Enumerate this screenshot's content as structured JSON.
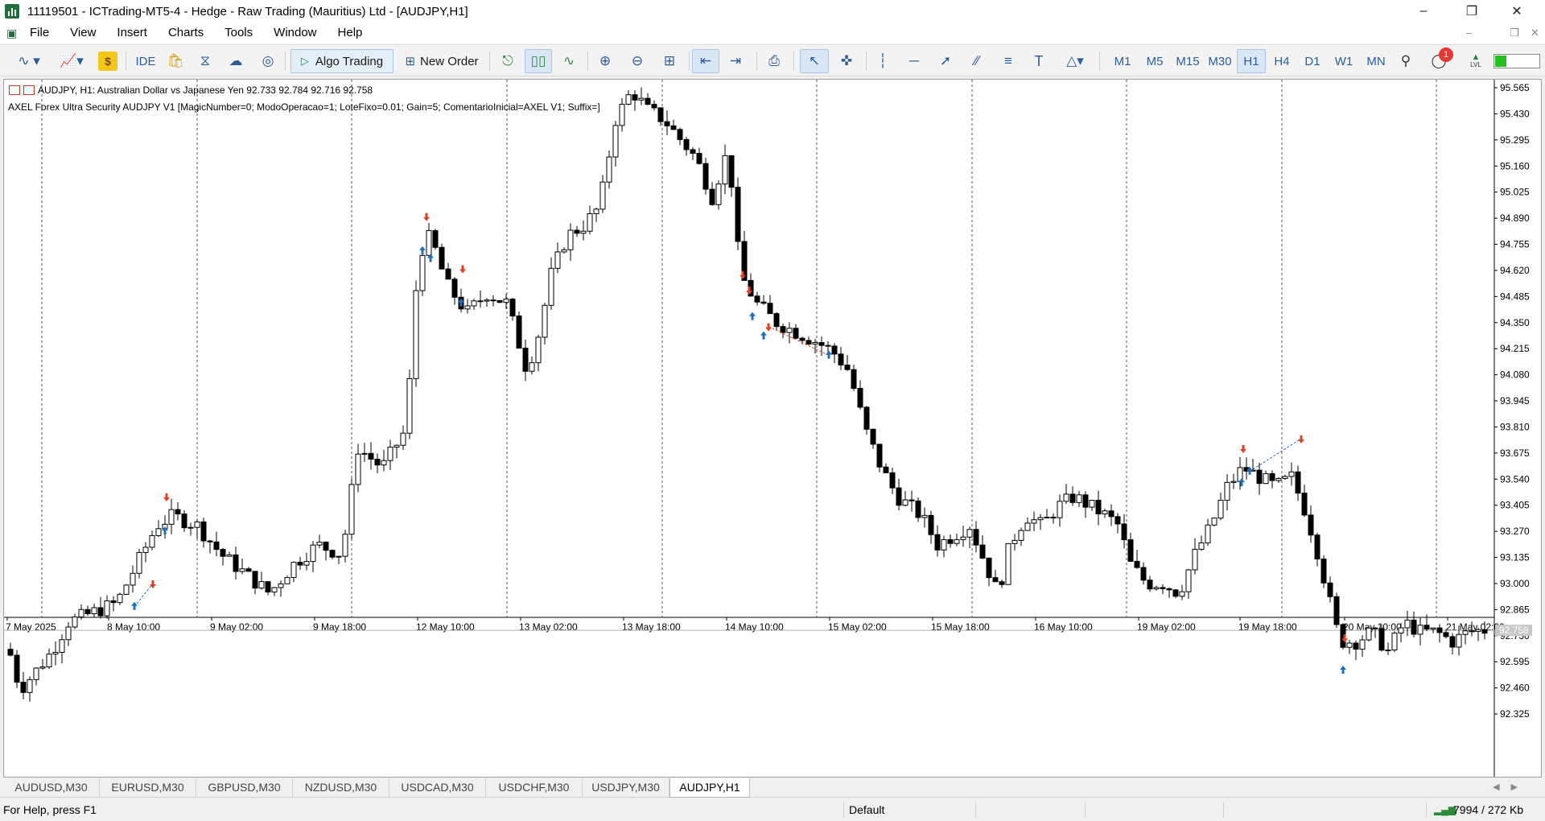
{
  "window": {
    "title": "11119501 - ICTrading-MT5-4 - Hedge - Raw Trading (Mauritius) Ltd - [AUDJPY,H1]"
  },
  "menu": [
    "File",
    "View",
    "Insert",
    "Charts",
    "Tools",
    "Window",
    "Help"
  ],
  "toolbar": {
    "ide_label": "IDE",
    "algo_trading_label": "Algo Trading",
    "new_order_label": "New Order",
    "timeframes": [
      "M1",
      "M5",
      "M15",
      "M30",
      "H1",
      "H4",
      "D1",
      "W1",
      "MN"
    ],
    "active_timeframe": "H1",
    "notification_count": "1",
    "lvl_label": "LVL"
  },
  "chart": {
    "info_line": "AUDJPY, H1:  Australian Dollar vs Japanese Yen  92.733 92.784 92.716 92.758",
    "ea_line": "AXEL Forex Ultra Security AUDJPY V1 [MagicNumber=0; ModoOperacao=1; LoteFixo=0.01; Gain=5; ComentarioInicial=AXEL V1; Suffix=]",
    "current_price": "92.758",
    "price_labels": [
      "95.565",
      "95.430",
      "95.295",
      "95.160",
      "95.025",
      "94.890",
      "94.755",
      "94.620",
      "94.485",
      "94.350",
      "94.215",
      "94.080",
      "93.945",
      "93.810",
      "93.675",
      "93.540",
      "93.405",
      "93.270",
      "93.135",
      "93.000",
      "92.865",
      "92.730",
      "92.595",
      "92.460",
      "92.325"
    ],
    "time_labels": [
      "7 May 2025",
      "8 May 10:00",
      "9 May 02:00",
      "9 May 18:00",
      "12 May 10:00",
      "13 May 02:00",
      "13 May 18:00",
      "14 May 10:00",
      "15 May 02:00",
      "15 May 18:00",
      "16 May 10:00",
      "19 May 02:00",
      "19 May 18:00",
      "20 May 10:00",
      "21 May 02:00"
    ]
  },
  "tabs": [
    "AUDUSD,M30",
    "EURUSD,M30",
    "GBPUSD,M30",
    "NZDUSD,M30",
    "USDCAD,M30",
    "USDCHF,M30",
    "USDJPY,M30",
    "AUDJPY,H1"
  ],
  "active_tab": "AUDJPY,H1",
  "status": {
    "help": "For Help, press F1",
    "profile": "Default",
    "traffic": "7994 / 272 Kb"
  },
  "colors": {
    "buy_arrow": "#1f6fc0",
    "sell_arrow": "#e04020",
    "accent": "#2a5d9a"
  },
  "icons": [
    "line-chart-icon",
    "indicator-icon",
    "dollar-icon",
    "market-bag-icon",
    "signal-icon",
    "cloud-icon",
    "vps-icon",
    "zoom-in-icon",
    "zoom-out-icon",
    "grid-icon",
    "autoscroll-icon",
    "shift-icon",
    "screenshot-icon",
    "cursor-icon",
    "crosshair-icon",
    "vertical-line-icon",
    "horizontal-line-icon",
    "trendline-icon",
    "channel-icon",
    "fibonacci-icon",
    "text-icon",
    "shapes-icon",
    "search-icon",
    "notifications-icon"
  ]
}
